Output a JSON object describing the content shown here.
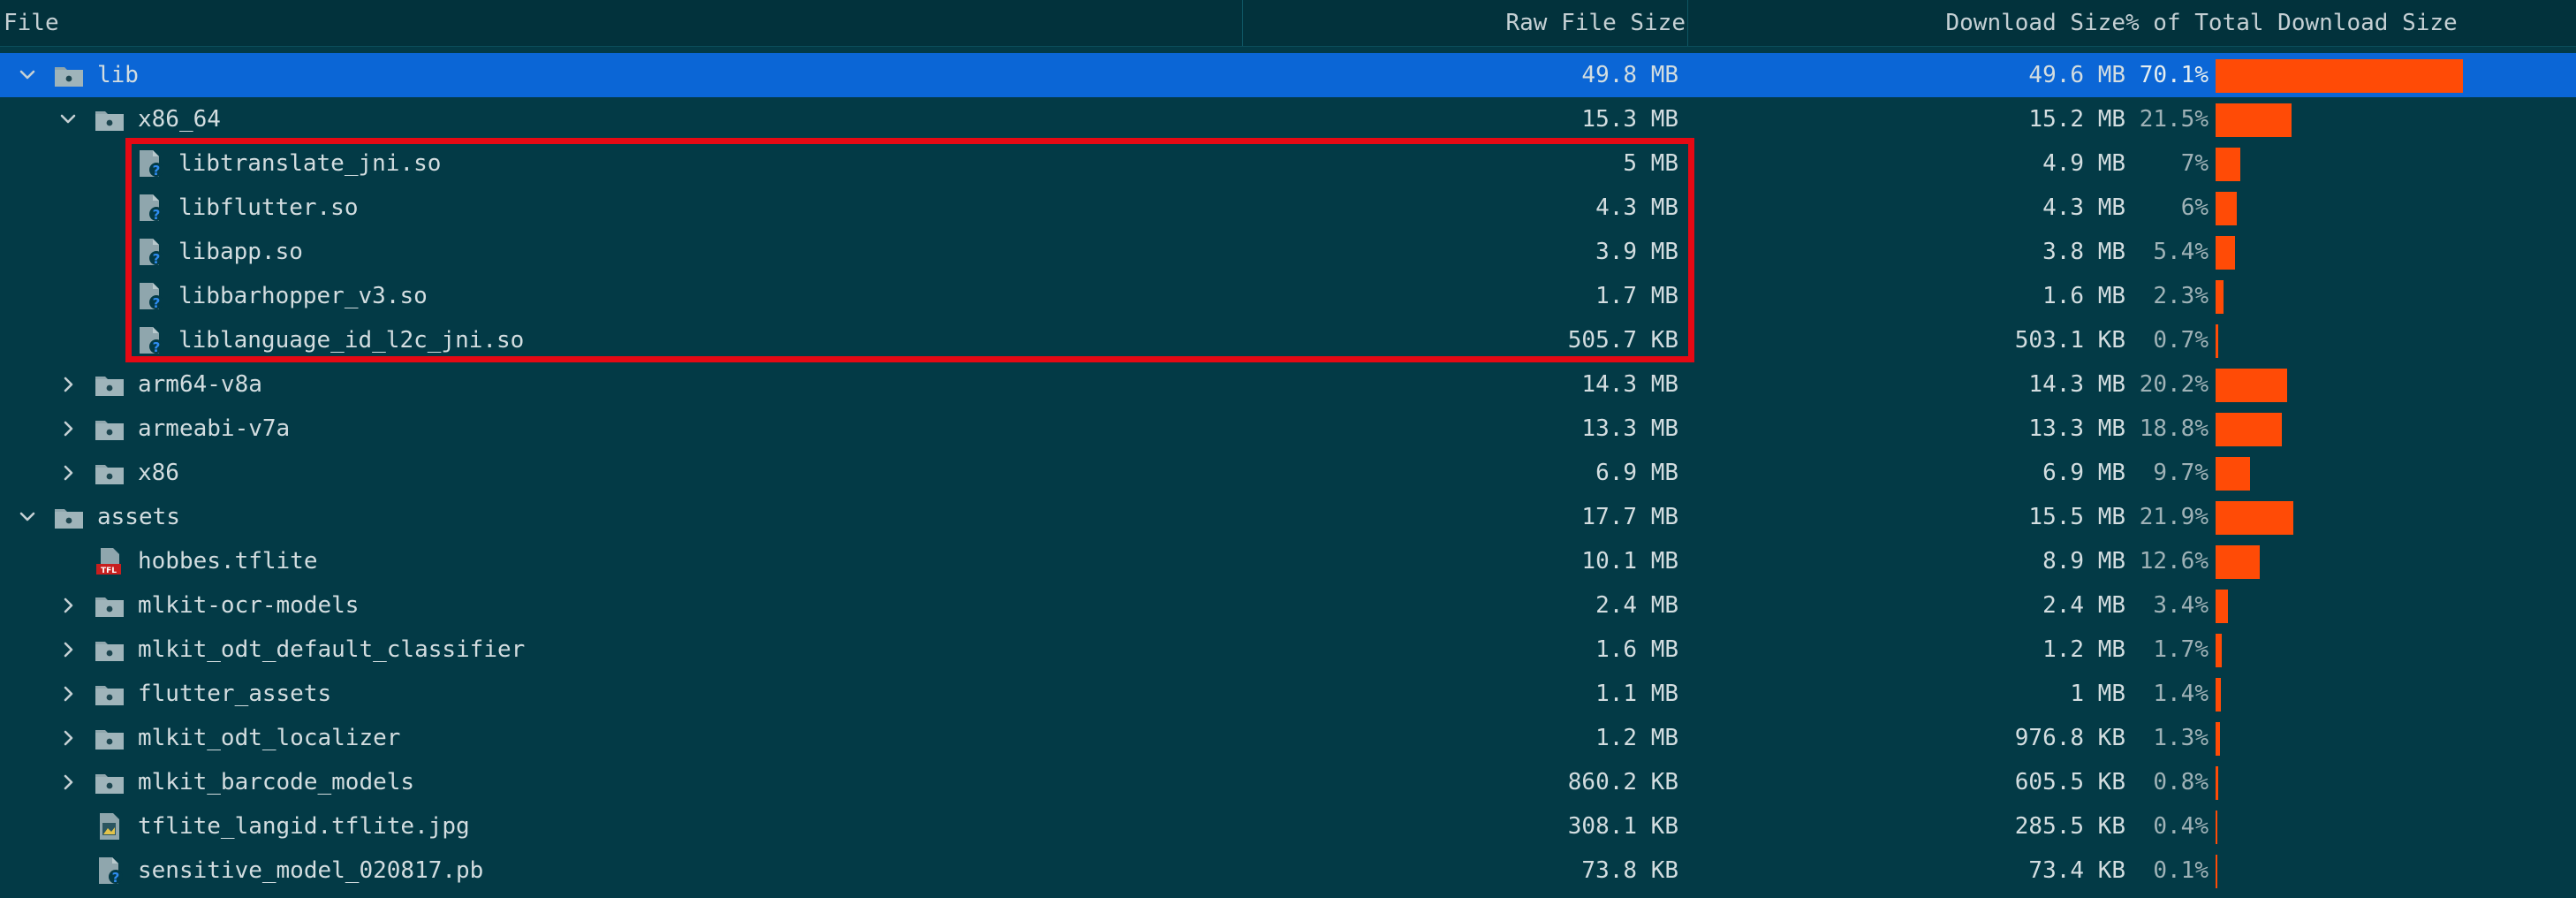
{
  "header": {
    "file": "File",
    "raw": "Raw File Size",
    "download": "Download Size",
    "percent": "% of Total Download Size"
  },
  "colors": {
    "background": "#033a46",
    "header_bg": "#02323c",
    "selection": "#0b66d6",
    "bar": "#ff4b06",
    "highlight_box": "#e50914"
  },
  "rows": [
    {
      "depth": 0,
      "expand": "open",
      "icon": "folder-icon",
      "name": "lib",
      "raw": "49.8 MB",
      "download": "49.6 MB",
      "percent": "70.1%",
      "fraction": 0.701,
      "selected": true
    },
    {
      "depth": 1,
      "expand": "open",
      "icon": "folder-icon",
      "name": "x86_64",
      "raw": "15.3 MB",
      "download": "15.2 MB",
      "percent": "21.5%",
      "fraction": 0.215
    },
    {
      "depth": 2,
      "expand": "none",
      "icon": "unknown-file-icon",
      "name": "libtranslate_jni.so",
      "raw": "5 MB",
      "download": "4.9 MB",
      "percent": "7%",
      "fraction": 0.07
    },
    {
      "depth": 2,
      "expand": "none",
      "icon": "unknown-file-icon",
      "name": "libflutter.so",
      "raw": "4.3 MB",
      "download": "4.3 MB",
      "percent": "6%",
      "fraction": 0.06
    },
    {
      "depth": 2,
      "expand": "none",
      "icon": "unknown-file-icon",
      "name": "libapp.so",
      "raw": "3.9 MB",
      "download": "3.8 MB",
      "percent": "5.4%",
      "fraction": 0.054
    },
    {
      "depth": 2,
      "expand": "none",
      "icon": "unknown-file-icon",
      "name": "libbarhopper_v3.so",
      "raw": "1.7 MB",
      "download": "1.6 MB",
      "percent": "2.3%",
      "fraction": 0.023
    },
    {
      "depth": 2,
      "expand": "none",
      "icon": "unknown-file-icon",
      "name": "liblanguage_id_l2c_jni.so",
      "raw": "505.7 KB",
      "download": "503.1 KB",
      "percent": "0.7%",
      "fraction": 0.007
    },
    {
      "depth": 1,
      "expand": "closed",
      "icon": "folder-icon",
      "name": "arm64-v8a",
      "raw": "14.3 MB",
      "download": "14.3 MB",
      "percent": "20.2%",
      "fraction": 0.202
    },
    {
      "depth": 1,
      "expand": "closed",
      "icon": "folder-icon",
      "name": "armeabi-v7a",
      "raw": "13.3 MB",
      "download": "13.3 MB",
      "percent": "18.8%",
      "fraction": 0.188
    },
    {
      "depth": 1,
      "expand": "closed",
      "icon": "folder-icon",
      "name": "x86",
      "raw": "6.9 MB",
      "download": "6.9 MB",
      "percent": "9.7%",
      "fraction": 0.097
    },
    {
      "depth": 0,
      "expand": "open",
      "icon": "folder-icon",
      "name": "assets",
      "raw": "17.7 MB",
      "download": "15.5 MB",
      "percent": "21.9%",
      "fraction": 0.219
    },
    {
      "depth": 1,
      "expand": "none",
      "icon": "tflite-file-icon",
      "name": "hobbes.tflite",
      "raw": "10.1 MB",
      "download": "8.9 MB",
      "percent": "12.6%",
      "fraction": 0.126
    },
    {
      "depth": 1,
      "expand": "closed",
      "icon": "folder-icon",
      "name": "mlkit-ocr-models",
      "raw": "2.4 MB",
      "download": "2.4 MB",
      "percent": "3.4%",
      "fraction": 0.034
    },
    {
      "depth": 1,
      "expand": "closed",
      "icon": "folder-icon",
      "name": "mlkit_odt_default_classifier",
      "raw": "1.6 MB",
      "download": "1.2 MB",
      "percent": "1.7%",
      "fraction": 0.017
    },
    {
      "depth": 1,
      "expand": "closed",
      "icon": "folder-icon",
      "name": "flutter_assets",
      "raw": "1.1 MB",
      "download": "1 MB",
      "percent": "1.4%",
      "fraction": 0.014
    },
    {
      "depth": 1,
      "expand": "closed",
      "icon": "folder-icon",
      "name": "mlkit_odt_localizer",
      "raw": "1.2 MB",
      "download": "976.8 KB",
      "percent": "1.3%",
      "fraction": 0.013
    },
    {
      "depth": 1,
      "expand": "closed",
      "icon": "folder-icon",
      "name": "mlkit_barcode_models",
      "raw": "860.2 KB",
      "download": "605.5 KB",
      "percent": "0.8%",
      "fraction": 0.008
    },
    {
      "depth": 1,
      "expand": "none",
      "icon": "image-file-icon",
      "name": "tflite_langid.tflite.jpg",
      "raw": "308.1 KB",
      "download": "285.5 KB",
      "percent": "0.4%",
      "fraction": 0.004
    },
    {
      "depth": 1,
      "expand": "none",
      "icon": "unknown-file-icon",
      "name": "sensitive_model_020817.pb",
      "raw": "73.8 KB",
      "download": "73.4 KB",
      "percent": "0.1%",
      "fraction": 0.001
    }
  ]
}
